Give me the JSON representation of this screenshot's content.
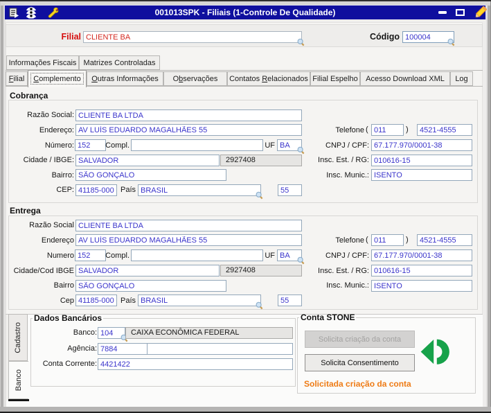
{
  "window": {
    "title": "001013SPK - Filiais (1-Controle De Qualidade)",
    "icons": [
      "export-icon",
      "semaphore-icon",
      "wrench-icon"
    ],
    "controls": [
      "minimize",
      "maximize",
      "edit-pencil"
    ]
  },
  "colors": {
    "titlebar": "#0f0f9e",
    "field_text_blue": "#3a34cb",
    "filial_red": "#d60f0f",
    "status_orange": "#ee7b15",
    "stone_green": "#17a24a"
  },
  "header": {
    "filial_label": "Filial",
    "filial_value": "CLIENTE BA",
    "codigo_label": "Código",
    "codigo_value": "100004"
  },
  "tabs_top": [
    {
      "label": "Informações Fiscais"
    },
    {
      "label": "Matrizes Controladas"
    }
  ],
  "tabs_main": [
    {
      "pre": "",
      "key": "F",
      "rest": "ilial"
    },
    {
      "pre": "",
      "key": "C",
      "rest": "omplemento",
      "active": true
    },
    {
      "pre": "",
      "key": "O",
      "rest": "utras Informações"
    },
    {
      "pre": "O",
      "key": "b",
      "rest": "servações"
    },
    {
      "pre": "Contatos ",
      "key": "R",
      "rest": "elacionados"
    },
    {
      "pre": "Filial Espelho",
      "key": "",
      "rest": ""
    },
    {
      "pre": "Acesso Download XML",
      "key": "",
      "rest": ""
    },
    {
      "pre": "Log",
      "key": "",
      "rest": ""
    }
  ],
  "cobranca": {
    "title": "Cobrança",
    "razao_label": "Razão Social:",
    "razao_value": "CLIENTE BA LTDA",
    "endereco_label": "Endereço:",
    "endereco_value": "AV LUÍS EDUARDO MAGALHÃES 55",
    "numero_label": "Número:",
    "numero_value": "152",
    "compl_label": "Compl.",
    "compl_value": "",
    "uf_label": "UF",
    "uf_value": "BA",
    "cidade_label": "Cidade / IBGE:",
    "cidade_value": "SALVADOR",
    "ibge_value": "2927408",
    "bairro_label": "Bairro:",
    "bairro_value": "SÃO GONÇALO",
    "cep_label": "CEP:",
    "cep_value": "41185-000",
    "pais_label": "País",
    "pais_value": "BRASIL",
    "ddi_value": "55",
    "telefone_label": "Telefone",
    "paren_open": "(",
    "paren_close": ")",
    "ddd_value": "011",
    "fone_value": "4521-4555",
    "cnpj_label": "CNPJ / CPF:",
    "cnpj_value": "67.177.970/0001-38",
    "ie_label": "Insc. Est. / RG:",
    "ie_value": "010616-15",
    "im_label": "Insc. Munic.:",
    "im_value": "ISENTO"
  },
  "entrega": {
    "title": "Entrega",
    "razao_label": "Razão Social",
    "razao_value": "CLIENTE BA LTDA",
    "endereco_label": "Endereço",
    "endereco_value": "AV LUÍS EDUARDO MAGALHÃES 55",
    "numero_label": "Numero",
    "numero_value": "152",
    "compl_label": "Compl.",
    "compl_value": "",
    "uf_label": "UF",
    "uf_value": "BA",
    "cidade_label": "Cidade/Cod IBGE",
    "cidade_value": "SALVADOR",
    "ibge_value": "2927408",
    "bairro_label": "Bairro",
    "bairro_value": "SÃO GONÇALO",
    "cep_label": "Cep",
    "cep_value": "41185-000",
    "pais_label": "País",
    "pais_value": "BRASIL",
    "ddi_value": "55",
    "telefone_label": "Telefone",
    "paren_open": "(",
    "paren_close": ")",
    "ddd_value": "011",
    "fone_value": "4521-4555",
    "cnpj_label": "CNPJ / CPF:",
    "cnpj_value": "67.177.970/0001-38",
    "ie_label": "Insc. Est. / RG:",
    "ie_value": "010616-15",
    "im_label": "Insc. Munic.:",
    "im_value": "ISENTO"
  },
  "bottom": {
    "side_tabs": [
      {
        "label": "Cadastro"
      },
      {
        "label": "Banco",
        "active": true
      }
    ],
    "dados_bancarios": {
      "title": "Dados Bancários",
      "banco_label": "Banco:",
      "banco_cod": "104",
      "banco_nome": "CAIXA ECONÔMICA FEDERAL",
      "agencia_label": "Agência:",
      "agencia_value": "7884",
      "agencia_dv": "",
      "conta_label": "Conta Corrente:",
      "conta_value": "4421422"
    },
    "conta_stone": {
      "title": "Conta STONE",
      "btn_criacao": "Solicita criação da conta",
      "btn_consentimento": "Solicita Consentimento",
      "status": "Solicitada criação da conta"
    }
  }
}
